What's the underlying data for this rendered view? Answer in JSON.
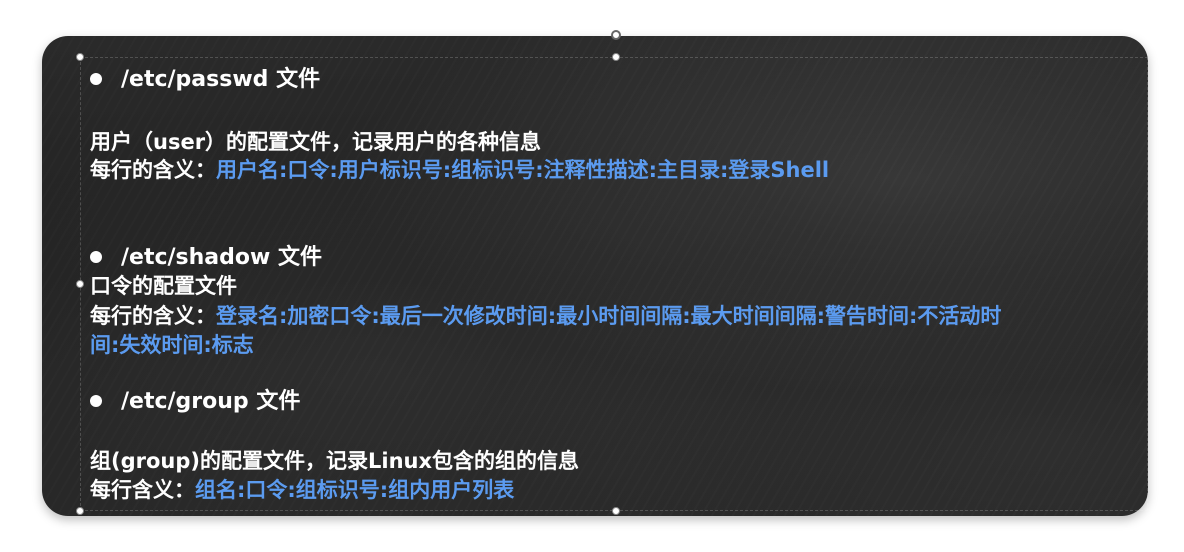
{
  "sections": [
    {
      "heading": "/etc/passwd 文件",
      "description": "用户（user）的配置文件，记录用户的各种信息",
      "meaning_label": "每行的含义：",
      "meaning_fields": "用户名:口令:用户标识号:组标识号:注释性描述:主目录:登录Shell"
    },
    {
      "heading": "/etc/shadow 文件",
      "description": "口令的配置文件",
      "meaning_label": "每行的含义：",
      "meaning_fields_line1": "登录名:加密口令:最后一次修改时间:最小时间间隔:最大时间间隔:警告时间:不活动时",
      "meaning_fields_line2": "间:失效时间:标志"
    },
    {
      "heading": "/etc/group 文件",
      "description": "组(group)的配置文件，记录Linux包含的组的信息",
      "meaning_label": "每行含义：",
      "meaning_fields": "组名:口令:组标识号:组内用户列表"
    }
  ],
  "colors": {
    "board_background": "#252525",
    "text": "#ffffff",
    "highlight": "#5b9bf0"
  }
}
